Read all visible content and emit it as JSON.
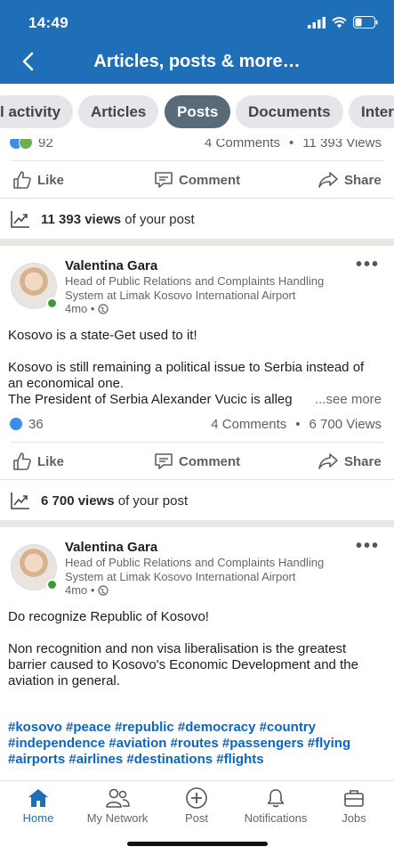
{
  "status": {
    "time": "14:49"
  },
  "header": {
    "title": "Articles, posts & more…"
  },
  "tabs": [
    {
      "label": "l activity"
    },
    {
      "label": "Articles"
    },
    {
      "label": "Posts",
      "active": true
    },
    {
      "label": "Documents"
    },
    {
      "label": "Inter"
    }
  ],
  "post0": {
    "reactions": "92",
    "comments": "4 Comments",
    "views_count": "11 393 Views",
    "actions": {
      "like": "Like",
      "comment": "Comment",
      "share": "Share"
    },
    "views_bold": "11 393 views",
    "views_suffix": "of your post"
  },
  "post1": {
    "author": "Valentina Gara",
    "headline": "Head of Public Relations and Complaints Handling System at Limak Kosovo International Airport",
    "time": "4mo •",
    "text1": "Kosovo is a state-Get used to it!",
    "text2": "Kosovo is still remaining a political issue to Serbia instead of an economical one.",
    "text3": "The President of Serbia Alexander Vucic is alleg",
    "see_more": "...see more",
    "reactions": "36",
    "comments": "4 Comments",
    "views_count": "6 700 Views",
    "actions": {
      "like": "Like",
      "comment": "Comment",
      "share": "Share"
    },
    "views_bold": "6 700 views",
    "views_suffix": "of your post"
  },
  "post2": {
    "author": "Valentina Gara",
    "headline": "Head of Public Relations and Complaints Handling System at Limak Kosovo International Airport",
    "time": "4mo •",
    "text1": "Do recognize Republic of Kosovo!",
    "text2": "Non recognition and non visa liberalisation is the greatest barrier caused to Kosovo's Economic Development and the aviation in general.",
    "hashtags": "#kosovo #peace #republic #democracy #country #independence #aviation  #routes #passengers #flying #airports #airlines  #destinations #flights"
  },
  "bottom_nav": [
    {
      "label": "Home",
      "icon": "home-icon",
      "active": true
    },
    {
      "label": "My Network",
      "icon": "network-icon"
    },
    {
      "label": "Post",
      "icon": "plus-icon"
    },
    {
      "label": "Notifications",
      "icon": "bell-icon"
    },
    {
      "label": "Jobs",
      "icon": "briefcase-icon"
    }
  ],
  "colors": {
    "brand": "#1e6eb8",
    "link": "#0a66c2",
    "online": "#3b9d3a"
  }
}
